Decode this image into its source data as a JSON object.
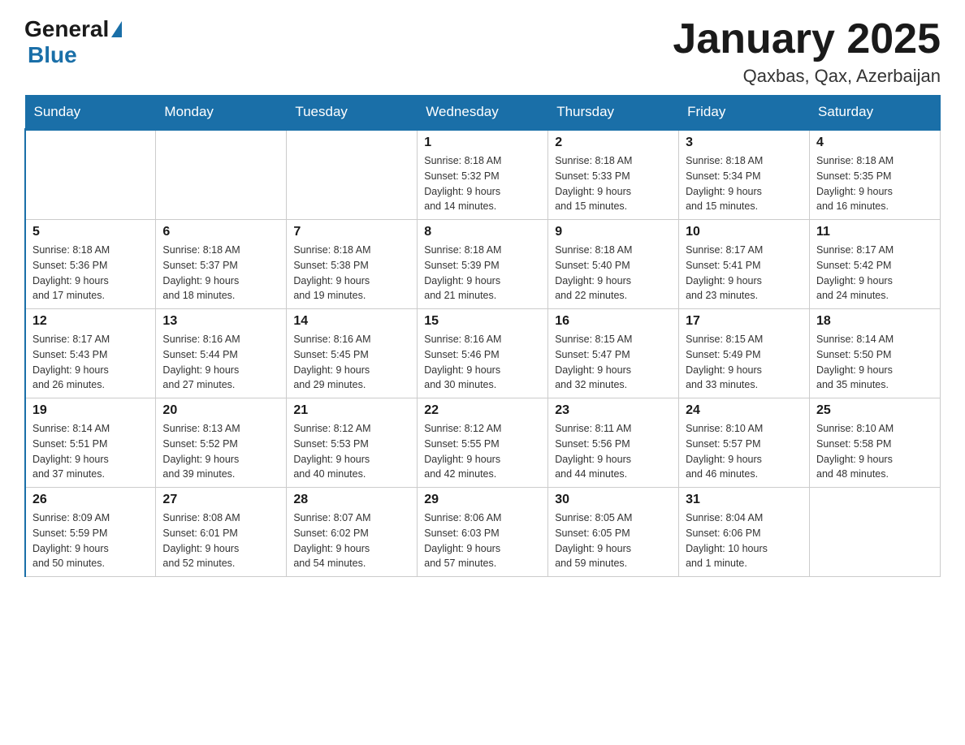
{
  "logo": {
    "general": "General",
    "blue": "Blue"
  },
  "title": "January 2025",
  "subtitle": "Qaxbas, Qax, Azerbaijan",
  "weekdays": [
    "Sunday",
    "Monday",
    "Tuesday",
    "Wednesday",
    "Thursday",
    "Friday",
    "Saturday"
  ],
  "weeks": [
    [
      {
        "day": "",
        "info": ""
      },
      {
        "day": "",
        "info": ""
      },
      {
        "day": "",
        "info": ""
      },
      {
        "day": "1",
        "info": "Sunrise: 8:18 AM\nSunset: 5:32 PM\nDaylight: 9 hours\nand 14 minutes."
      },
      {
        "day": "2",
        "info": "Sunrise: 8:18 AM\nSunset: 5:33 PM\nDaylight: 9 hours\nand 15 minutes."
      },
      {
        "day": "3",
        "info": "Sunrise: 8:18 AM\nSunset: 5:34 PM\nDaylight: 9 hours\nand 15 minutes."
      },
      {
        "day": "4",
        "info": "Sunrise: 8:18 AM\nSunset: 5:35 PM\nDaylight: 9 hours\nand 16 minutes."
      }
    ],
    [
      {
        "day": "5",
        "info": "Sunrise: 8:18 AM\nSunset: 5:36 PM\nDaylight: 9 hours\nand 17 minutes."
      },
      {
        "day": "6",
        "info": "Sunrise: 8:18 AM\nSunset: 5:37 PM\nDaylight: 9 hours\nand 18 minutes."
      },
      {
        "day": "7",
        "info": "Sunrise: 8:18 AM\nSunset: 5:38 PM\nDaylight: 9 hours\nand 19 minutes."
      },
      {
        "day": "8",
        "info": "Sunrise: 8:18 AM\nSunset: 5:39 PM\nDaylight: 9 hours\nand 21 minutes."
      },
      {
        "day": "9",
        "info": "Sunrise: 8:18 AM\nSunset: 5:40 PM\nDaylight: 9 hours\nand 22 minutes."
      },
      {
        "day": "10",
        "info": "Sunrise: 8:17 AM\nSunset: 5:41 PM\nDaylight: 9 hours\nand 23 minutes."
      },
      {
        "day": "11",
        "info": "Sunrise: 8:17 AM\nSunset: 5:42 PM\nDaylight: 9 hours\nand 24 minutes."
      }
    ],
    [
      {
        "day": "12",
        "info": "Sunrise: 8:17 AM\nSunset: 5:43 PM\nDaylight: 9 hours\nand 26 minutes."
      },
      {
        "day": "13",
        "info": "Sunrise: 8:16 AM\nSunset: 5:44 PM\nDaylight: 9 hours\nand 27 minutes."
      },
      {
        "day": "14",
        "info": "Sunrise: 8:16 AM\nSunset: 5:45 PM\nDaylight: 9 hours\nand 29 minutes."
      },
      {
        "day": "15",
        "info": "Sunrise: 8:16 AM\nSunset: 5:46 PM\nDaylight: 9 hours\nand 30 minutes."
      },
      {
        "day": "16",
        "info": "Sunrise: 8:15 AM\nSunset: 5:47 PM\nDaylight: 9 hours\nand 32 minutes."
      },
      {
        "day": "17",
        "info": "Sunrise: 8:15 AM\nSunset: 5:49 PM\nDaylight: 9 hours\nand 33 minutes."
      },
      {
        "day": "18",
        "info": "Sunrise: 8:14 AM\nSunset: 5:50 PM\nDaylight: 9 hours\nand 35 minutes."
      }
    ],
    [
      {
        "day": "19",
        "info": "Sunrise: 8:14 AM\nSunset: 5:51 PM\nDaylight: 9 hours\nand 37 minutes."
      },
      {
        "day": "20",
        "info": "Sunrise: 8:13 AM\nSunset: 5:52 PM\nDaylight: 9 hours\nand 39 minutes."
      },
      {
        "day": "21",
        "info": "Sunrise: 8:12 AM\nSunset: 5:53 PM\nDaylight: 9 hours\nand 40 minutes."
      },
      {
        "day": "22",
        "info": "Sunrise: 8:12 AM\nSunset: 5:55 PM\nDaylight: 9 hours\nand 42 minutes."
      },
      {
        "day": "23",
        "info": "Sunrise: 8:11 AM\nSunset: 5:56 PM\nDaylight: 9 hours\nand 44 minutes."
      },
      {
        "day": "24",
        "info": "Sunrise: 8:10 AM\nSunset: 5:57 PM\nDaylight: 9 hours\nand 46 minutes."
      },
      {
        "day": "25",
        "info": "Sunrise: 8:10 AM\nSunset: 5:58 PM\nDaylight: 9 hours\nand 48 minutes."
      }
    ],
    [
      {
        "day": "26",
        "info": "Sunrise: 8:09 AM\nSunset: 5:59 PM\nDaylight: 9 hours\nand 50 minutes."
      },
      {
        "day": "27",
        "info": "Sunrise: 8:08 AM\nSunset: 6:01 PM\nDaylight: 9 hours\nand 52 minutes."
      },
      {
        "day": "28",
        "info": "Sunrise: 8:07 AM\nSunset: 6:02 PM\nDaylight: 9 hours\nand 54 minutes."
      },
      {
        "day": "29",
        "info": "Sunrise: 8:06 AM\nSunset: 6:03 PM\nDaylight: 9 hours\nand 57 minutes."
      },
      {
        "day": "30",
        "info": "Sunrise: 8:05 AM\nSunset: 6:05 PM\nDaylight: 9 hours\nand 59 minutes."
      },
      {
        "day": "31",
        "info": "Sunrise: 8:04 AM\nSunset: 6:06 PM\nDaylight: 10 hours\nand 1 minute."
      },
      {
        "day": "",
        "info": ""
      }
    ]
  ]
}
